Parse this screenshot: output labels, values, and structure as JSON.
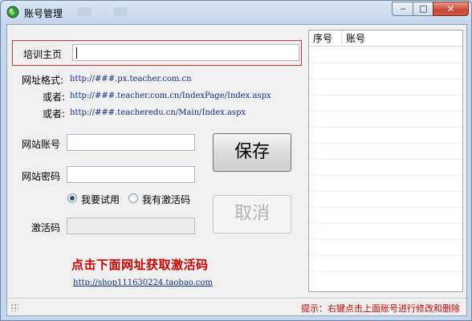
{
  "window": {
    "title": "账号管理",
    "controls": {
      "minimize": "‒",
      "maximize": "□",
      "close": "✕"
    }
  },
  "form": {
    "training_home_label": "培训主页",
    "training_home_value": "",
    "url_format_label": "网址格式:",
    "url_format_1": "http://###.px.teacher.com.cn",
    "or_label_1": "或者:",
    "url_format_2": "http://###.teacher.com.cn/IndexPage/Index.aspx",
    "or_label_2": "或者:",
    "url_format_3": "http://###.teacheredu.cn/Main/Index.aspx",
    "account_label": "网站账号",
    "account_value": "",
    "password_label": "网站密码",
    "password_value": "",
    "radio_trial_label": "我要试用",
    "radio_trial_checked": true,
    "radio_code_label": "我有激活码",
    "radio_code_checked": false,
    "activation_label": "激活码",
    "activation_value": ""
  },
  "buttons": {
    "save": "保存",
    "cancel": "取消"
  },
  "promo": {
    "text": "点击下面网址获取激活码",
    "link": "http://shop111630224.taobao.com"
  },
  "account_list": {
    "columns": [
      "序号",
      "账号"
    ],
    "rows": []
  },
  "statusbar": {
    "hint": "提示：右键点击上面账号进行修改和删除"
  },
  "colors": {
    "accent_red": "#d40000",
    "link_blue": "#0e2c8e",
    "highlight_border": "#d9302b"
  },
  "icons": {
    "app": "green-globe-icon",
    "grip": "resize-grip-icon"
  }
}
